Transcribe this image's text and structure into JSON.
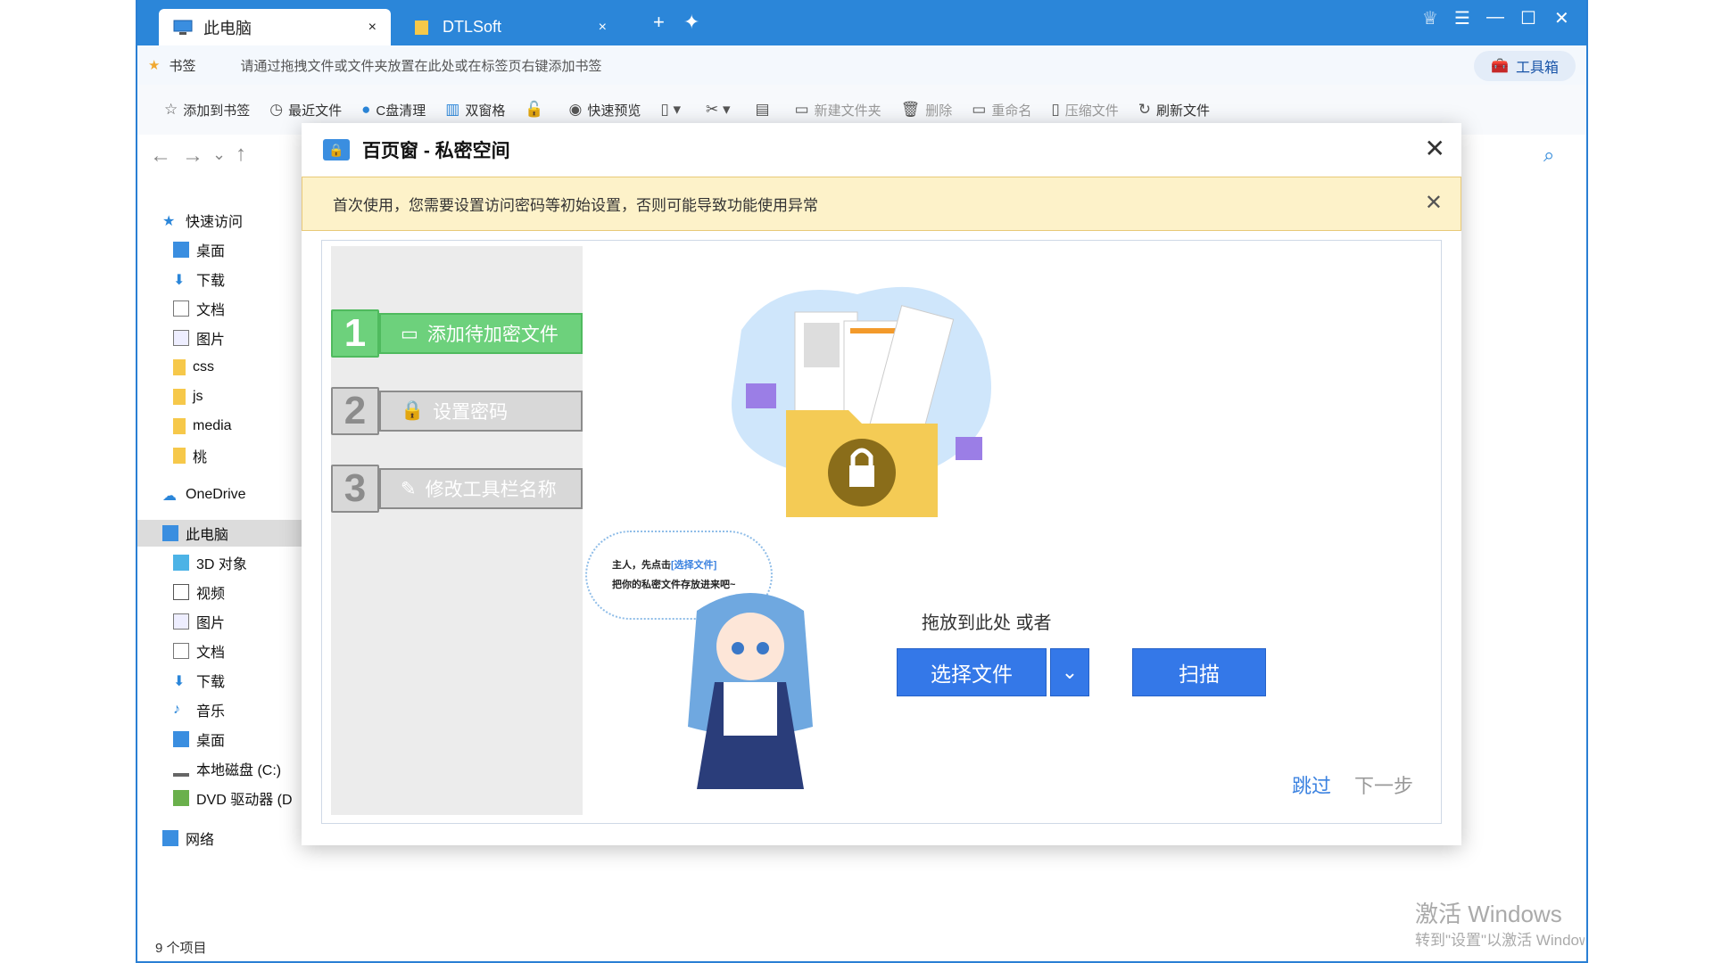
{
  "tabs": [
    {
      "label": "此电脑",
      "close": "×"
    },
    {
      "label": "DTLSoft",
      "close": "×"
    }
  ],
  "bookmarks": {
    "label": "书签",
    "hint": "请通过拖拽文件或文件夹放置在此处或在标签页右键添加书签",
    "toolbox": "工具箱"
  },
  "toolbar": {
    "add_bookmark": "添加到书签",
    "recent": "最近文件",
    "c_clean": "C盘清理",
    "dual_pane": "双窗格",
    "quick_preview": "快速预览",
    "new_folder": "新建文件夹",
    "delete": "删除",
    "rename": "重命名",
    "compress": "压缩文件",
    "refresh": "刷新文件"
  },
  "sidebar": {
    "quick_access": "快速访问",
    "items_top": [
      "桌面",
      "下载",
      "文档",
      "图片",
      "css",
      "js",
      "media",
      "桃"
    ],
    "onedrive": "OneDrive",
    "this_pc": "此电脑",
    "items_pc": [
      "3D 对象",
      "视频",
      "图片",
      "文档",
      "下载",
      "音乐",
      "桌面",
      "本地磁盘 (C:)",
      "DVD 驱动器 (D"
    ],
    "network": "网络"
  },
  "status": {
    "count": "9 个项目"
  },
  "watermark": {
    "line1": "激活 Windows",
    "line2": "转到\"设置\"以激活 Windows"
  },
  "dialog": {
    "title": "百页窗 - 私密空间",
    "notice": "首次使用，您需要设置访问密码等初始设置，否则可能导致功能使用异常",
    "steps": [
      {
        "num": "1",
        "label": "添加待加密文件"
      },
      {
        "num": "2",
        "label": "设置密码"
      },
      {
        "num": "3",
        "label": "修改工具栏名称"
      }
    ],
    "bubble_line1_pre": "主人，先点击",
    "bubble_line1_hl": "[选择文件]",
    "bubble_line2": "把你的私密文件存放进来吧~",
    "drop_label": "拖放到此处 或者",
    "choose_button": "选择文件",
    "scan_button": "扫描",
    "skip": "跳过",
    "next": "下一步"
  },
  "colors": {
    "title_blue": "#2b86d9",
    "primary_btn": "#3478e8",
    "step_active": "#6dd17c",
    "notice_bg": "#fdf2c9"
  }
}
